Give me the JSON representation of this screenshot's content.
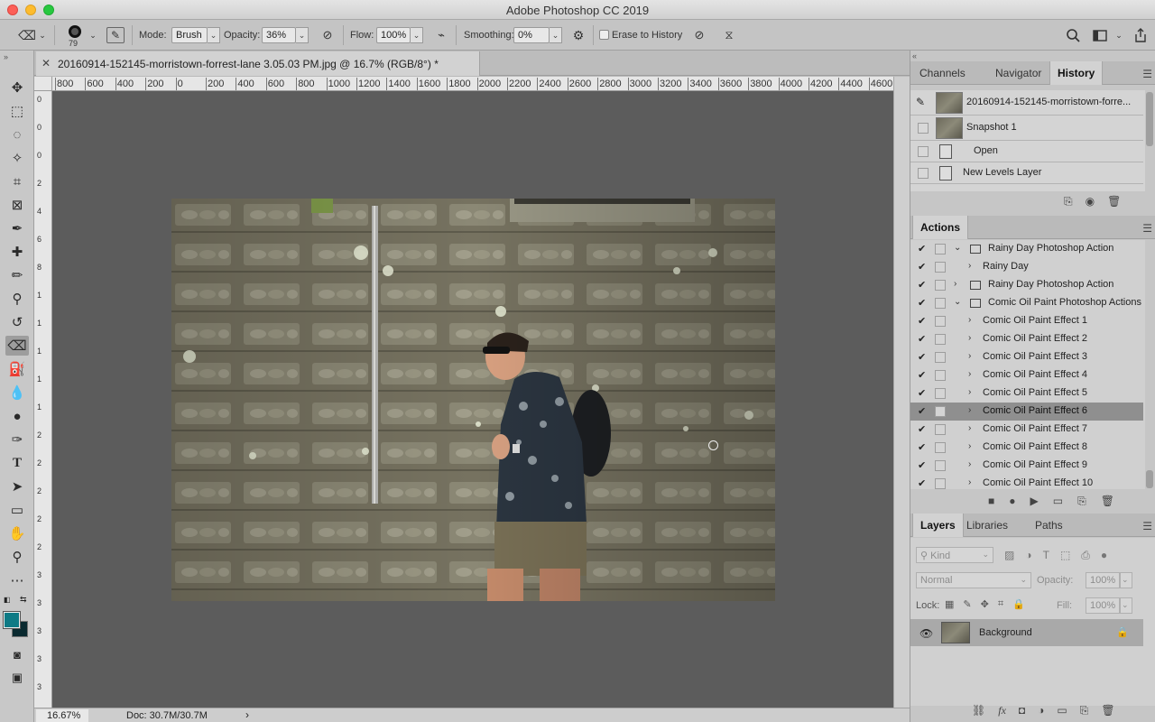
{
  "app": {
    "title": "Adobe Photoshop CC 2019"
  },
  "options": {
    "brush_size": "79",
    "mode_label": "Mode:",
    "mode_value": "Brush",
    "opacity_label": "Opacity:",
    "opacity_value": "36%",
    "flow_label": "Flow:",
    "flow_value": "100%",
    "smoothing_label": "Smoothing:",
    "smoothing_value": "0%",
    "erase_history_label": "Erase to History"
  },
  "document": {
    "tab_label": "20160914-152145-morristown-forrest-lane 3.05.03 PM.jpg @ 16.7% (RGB/8°) *",
    "ruler_labels": [
      "800",
      "600",
      "400",
      "200",
      "0",
      "200",
      "400",
      "600",
      "800",
      "1000",
      "1200",
      "1400",
      "1600",
      "1800",
      "2000",
      "2200",
      "2400",
      "2600",
      "2800",
      "3000",
      "3200",
      "3400",
      "3600",
      "3800",
      "4000",
      "4200",
      "4400",
      "4600"
    ],
    "vruler_labels": [
      "0",
      "0",
      "0",
      "2",
      "4",
      "6",
      "8",
      "1",
      "1",
      "1",
      "1",
      "1",
      "2",
      "2",
      "2",
      "2",
      "2",
      "3",
      "3",
      "3",
      "3",
      "3"
    ]
  },
  "status": {
    "zoom": "16.67%",
    "doc_info": "Doc: 30.7M/30.7M",
    "arrow": "›"
  },
  "history_panel": {
    "tabs": [
      "Channels",
      "Navigator",
      "History"
    ],
    "items": [
      {
        "label": "20160914-152145-morristown-forre..."
      },
      {
        "label": "Snapshot 1"
      },
      {
        "label": "Open"
      },
      {
        "label": "New Levels Layer"
      }
    ]
  },
  "actions_panel": {
    "title": "Actions",
    "items": [
      {
        "label": "Rainy Day Photoshop Action",
        "level": 1,
        "expanded": true
      },
      {
        "label": "Rainy Day",
        "level": 2
      },
      {
        "label": "Rainy Day Photoshop Action",
        "level": 1
      },
      {
        "label": "Comic Oil Paint Photoshop Actions",
        "level": 1,
        "expanded": true
      },
      {
        "label": "Comic Oil Paint Effect 1",
        "level": 2
      },
      {
        "label": "Comic Oil Paint Effect 2",
        "level": 2
      },
      {
        "label": "Comic Oil Paint Effect 3",
        "level": 2
      },
      {
        "label": "Comic Oil Paint Effect 4",
        "level": 2
      },
      {
        "label": "Comic Oil Paint Effect 5",
        "level": 2
      },
      {
        "label": "Comic Oil Paint Effect 6",
        "level": 2,
        "selected": true
      },
      {
        "label": "Comic Oil Paint Effect 7",
        "level": 2
      },
      {
        "label": "Comic Oil Paint Effect 8",
        "level": 2
      },
      {
        "label": "Comic Oil Paint Effect 9",
        "level": 2
      },
      {
        "label": "Comic Oil Paint Effect 10",
        "level": 2
      }
    ]
  },
  "layers_panel": {
    "tabs": [
      "Layers",
      "Libraries",
      "Paths"
    ],
    "kind_label": "Kind",
    "blend_mode": "Normal",
    "opacity_label": "Opacity:",
    "opacity_value": "100%",
    "lock_label": "Lock:",
    "fill_label": "Fill:",
    "fill_value": "100%",
    "layer_name": "Background"
  },
  "colors": {
    "foreground": "#0e7a85",
    "background": "#0a2a30",
    "canvas_bg": "#5c5c5c"
  }
}
